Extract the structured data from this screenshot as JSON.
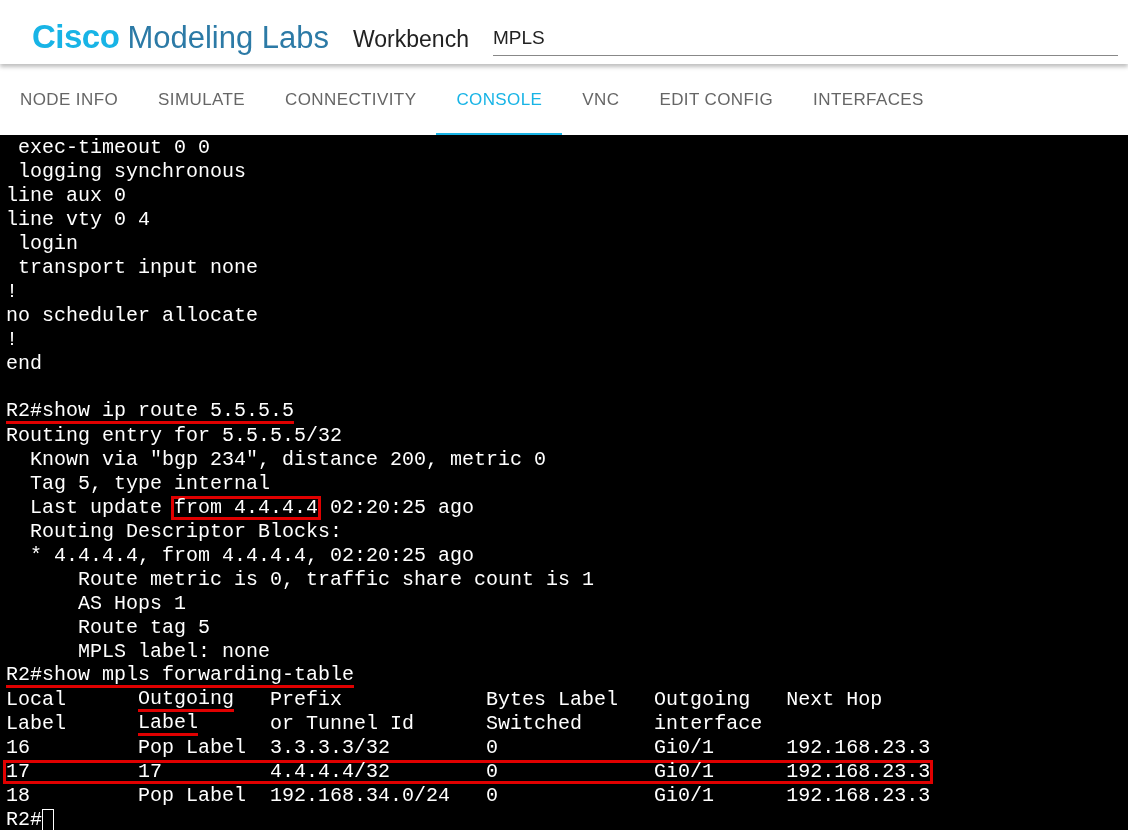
{
  "header": {
    "brand_strong": "Cisco",
    "brand_rest": "Modeling Labs",
    "section": "Workbench",
    "lab_name": "MPLS"
  },
  "tabs": [
    {
      "label": "NODE INFO",
      "selected": false
    },
    {
      "label": "SIMULATE",
      "selected": false
    },
    {
      "label": "CONNECTIVITY",
      "selected": false
    },
    {
      "label": "CONSOLE",
      "selected": true
    },
    {
      "label": "VNC",
      "selected": false
    },
    {
      "label": "EDIT CONFIG",
      "selected": false
    },
    {
      "label": "INTERFACES",
      "selected": false
    }
  ],
  "console": {
    "blocks": [
      [
        " exec-timeout 0 0",
        " logging synchronous",
        "line aux 0",
        "line vty 0 4",
        " login",
        " transport input none",
        "!",
        "no scheduler allocate",
        "!",
        "end"
      ],
      [
        [
          {
            "text": "R2#show ip route 5.5.5.5",
            "kind": "underlined"
          }
        ],
        "Routing entry for 5.5.5.5/32",
        "  Known via \"bgp 234\", distance 200, metric 0",
        "  Tag 5, type internal",
        [
          {
            "text": "  Last update ",
            "kind": "plain"
          },
          {
            "text": "from 4.4.4.4",
            "kind": "boxed"
          },
          {
            "text": " 02:20:25 ago",
            "kind": "plain"
          }
        ],
        "  Routing Descriptor Blocks:",
        "  * 4.4.4.4, from 4.4.4.4, 02:20:25 ago",
        "      Route metric is 0, traffic share count is 1",
        "      AS Hops 1",
        "      Route tag 5",
        "      MPLS label: none",
        [
          {
            "text": "R2#show mpls forwarding-table",
            "kind": "underlined"
          }
        ],
        [
          {
            "text": "Local      ",
            "kind": "plain"
          },
          {
            "text": "Outgoing",
            "kind": "underlined"
          },
          {
            "text": "   Prefix            Bytes Label   Outgoing   Next Hop",
            "kind": "plain"
          }
        ],
        [
          {
            "text": "Label      ",
            "kind": "plain"
          },
          {
            "text": "Label",
            "kind": "underlined"
          },
          {
            "text": "      or Tunnel Id      Switched      interface",
            "kind": "plain"
          }
        ],
        "16         Pop Label  3.3.3.3/32        0             Gi0/1      192.168.23.3",
        [
          {
            "text": "17         17         4.4.4.4/32        0             Gi0/1      192.168.23.3",
            "kind": "boxed"
          }
        ],
        "18         Pop Label  192.168.34.0/24   0             Gi0/1      192.168.23.3",
        "R2#"
      ]
    ]
  }
}
